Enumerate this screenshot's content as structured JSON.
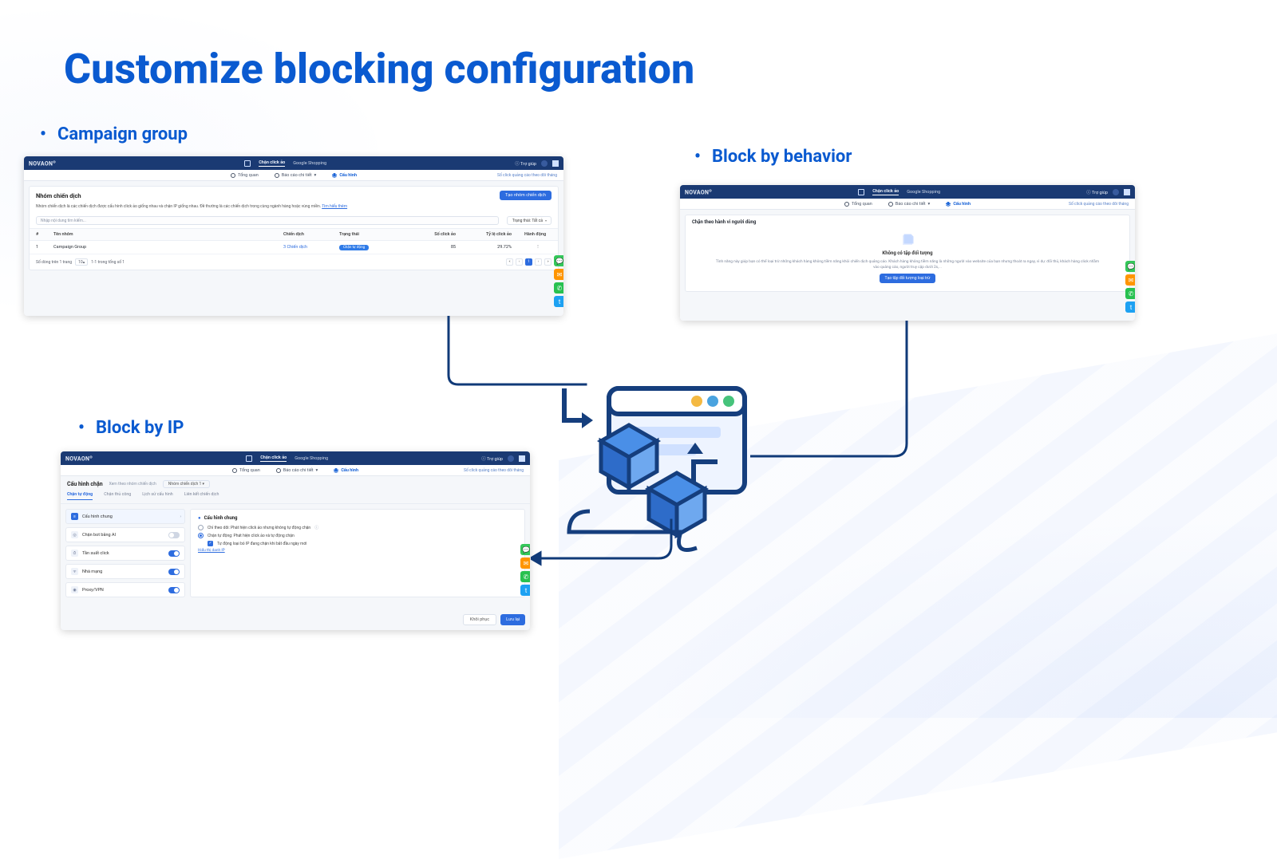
{
  "slide": {
    "title": "Customize blocking configuration",
    "bullet_campaign_group": "Campaign group",
    "bullet_block_by_ip": "Block by IP",
    "bullet_block_by_behavior": "Block by behavior"
  },
  "topbar": {
    "brand": "NOVAON",
    "help": "Trợ giúp",
    "nav_click_fraud": "Chặn click ảo",
    "nav_shopping": "Google Shopping"
  },
  "subbar": {
    "overview": "Tổng quan",
    "detail": "Báo cáo chi tiết",
    "config": "Cấu hình",
    "note": "Số click quảng cáo theo dõi tháng"
  },
  "s1": {
    "title": "Nhóm chiến dịch",
    "btn_create": "Tạo nhóm chiến dịch",
    "desc": "Nhóm chiến dịch là các chiến dịch được cấu hình click ảo giống nhau và chặn IP giống nhau. Đề thường là các chiến dịch trong cùng ngành hàng hoặc vùng miền.",
    "learn_more": "Tìm hiểu thêm",
    "search_placeholder": "Nhập nội dung tìm kiếm...",
    "filter_status": "Trạng thái: Tất cả",
    "col_idx": "#",
    "col_name": "Tên nhóm",
    "col_campaign": "Chiến dịch",
    "col_status": "Trạng thái",
    "col_clicks": "Số click ảo",
    "col_ratio": "Tỷ lệ click ảo",
    "col_action": "Hành động",
    "row_idx": "1",
    "row_name": "Campaign Group",
    "row_campaign": "3 Chiến dịch",
    "row_status": "Chặn tự động",
    "row_clicks": "85",
    "row_ratio": "29.72%",
    "row_action": "⋮",
    "foot_left_a": "Số dòng trên 1 trang",
    "foot_left_b": "10",
    "foot_left_c": "1-1 trong tổng số 1"
  },
  "s2": {
    "crumb_title": "Cấu hình chặn",
    "crumb_grey": "Xem theo nhóm chiến dịch",
    "crumb_tag": "Nhóm chiến dịch 1",
    "tab_auto": "Chặn tự động",
    "tab_manual": "Chặn thủ công",
    "tab_history": "Lịch sử cấu hình",
    "tab_link": "Liên kết chiến dịch",
    "tile_general": "Cấu hình chung",
    "tile_ai": "Chặn bot bằng AI",
    "tile_freq": "Tần suất click",
    "tile_network": "Nhà mạng",
    "tile_proxy": "Proxy/VPN",
    "rc_title": "Cấu hình chung",
    "opt_monitor": "Chỉ theo dõi: Phát hiện click ảo nhưng không tự động chặn",
    "opt_auto": "Chặn tự động: Phát hiện click ảo và tự động chặn",
    "opt_autosub": "Tự động loại bỏ IP đang chặn khi bắt đầu ngày mới",
    "hint": "Hiểu thị danh IP",
    "btn_restore": "Khôi phục",
    "btn_save": "Lưu lại"
  },
  "s3": {
    "panel_title": "Chặn theo hành vi người dùng",
    "empty_title": "Không có tập đối tượng",
    "empty_desc": "Tính năng này giúp bạn có thể loại trừ những khách hàng không tiềm năng khỏi chiến dịch quảng cáo. Khách hàng không tiềm năng là những người vào website của bạn nhưng thoát ra ngay, vì dụ: đối thủ, khách hàng click nhầm vào quảng cáo, người truy cập dưới 2s,...",
    "empty_btn": "Tạo tập đối tượng loại trừ"
  }
}
